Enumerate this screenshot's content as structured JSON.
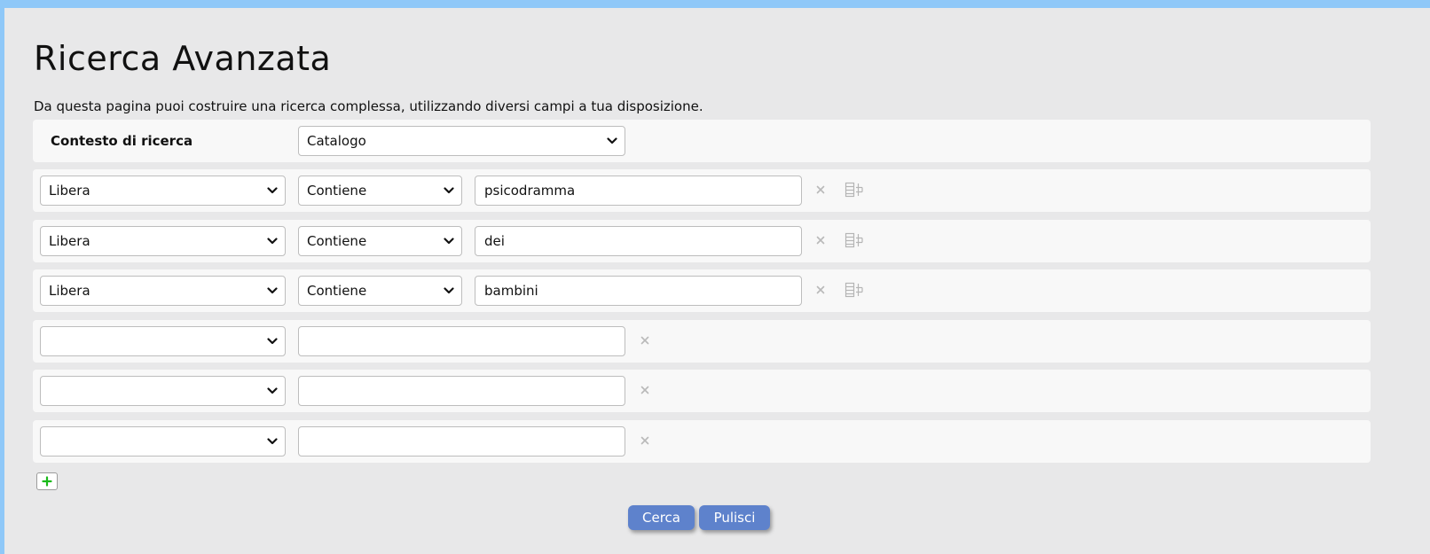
{
  "header": {
    "title": "Ricerca Avanzata",
    "description": "Da questa pagina puoi costruire una ricerca complessa, utilizzando diversi campi a tua disposizione."
  },
  "context": {
    "label": "Contesto di ricerca",
    "selected": "Catalogo"
  },
  "rows": [
    {
      "field": "Libera",
      "operator": "Contiene",
      "value": "psicodramma"
    },
    {
      "field": "Libera",
      "operator": "Contiene",
      "value": "dei"
    },
    {
      "field": "Libera",
      "operator": "Contiene",
      "value": "bambini"
    },
    {
      "field": "",
      "value": ""
    },
    {
      "field": "",
      "value": ""
    },
    {
      "field": "",
      "value": ""
    }
  ],
  "buttons": {
    "search": "Cerca",
    "clear": "Pulisci"
  },
  "icons": {
    "remove": "close-icon",
    "group": "group-icon",
    "add": "plus-icon",
    "dropdown": "chevron-down-icon"
  },
  "colors": {
    "page_border": "#8fc8f8",
    "panel_bg": "#e8e8e9",
    "row_bg": "#f8f8f8",
    "button_bg": "#5e82cc",
    "add_icon": "#19b919"
  }
}
